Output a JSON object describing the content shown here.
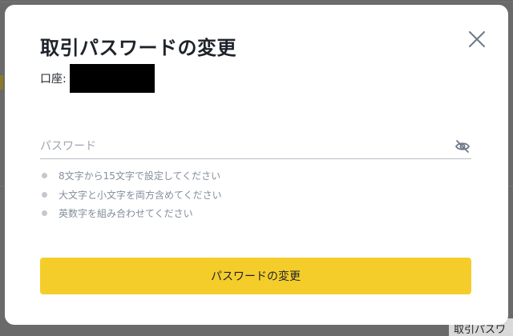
{
  "background": {
    "peek_text": "取引パスワ"
  },
  "modal": {
    "title": "取引パスワードの変更",
    "close_icon": "close-icon",
    "account": {
      "label": "口座:"
    },
    "password_field": {
      "value": "",
      "placeholder": "パスワード",
      "toggle_icon": "eye-slash-icon"
    },
    "rules": [
      {
        "text": "8文字から15文字で設定してください"
      },
      {
        "text": "大文字と小文字を両方含めてください"
      },
      {
        "text": "英数字を組み合わせてください"
      }
    ],
    "submit_label": "パスワードの変更"
  },
  "colors": {
    "accent": "#F5CD2A",
    "overlay": "#5F5F5F",
    "text": "#1E2329",
    "muted": "#848E9C"
  }
}
